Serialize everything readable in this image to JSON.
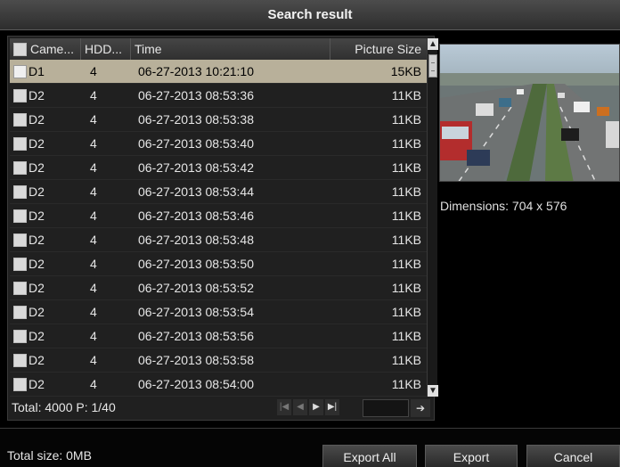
{
  "window": {
    "title": "Search result"
  },
  "table": {
    "headers": {
      "camera": "Came...",
      "hdd": "HDD...",
      "time": "Time",
      "size": "Picture Size"
    },
    "rows": [
      {
        "camera": "D1",
        "hdd": "4",
        "time": "06-27-2013 10:21:10",
        "size": "15KB",
        "selected": true
      },
      {
        "camera": "D2",
        "hdd": "4",
        "time": "06-27-2013 08:53:36",
        "size": "11KB"
      },
      {
        "camera": "D2",
        "hdd": "4",
        "time": "06-27-2013 08:53:38",
        "size": "11KB"
      },
      {
        "camera": "D2",
        "hdd": "4",
        "time": "06-27-2013 08:53:40",
        "size": "11KB"
      },
      {
        "camera": "D2",
        "hdd": "4",
        "time": "06-27-2013 08:53:42",
        "size": "11KB"
      },
      {
        "camera": "D2",
        "hdd": "4",
        "time": "06-27-2013 08:53:44",
        "size": "11KB"
      },
      {
        "camera": "D2",
        "hdd": "4",
        "time": "06-27-2013 08:53:46",
        "size": "11KB"
      },
      {
        "camera": "D2",
        "hdd": "4",
        "time": "06-27-2013 08:53:48",
        "size": "11KB"
      },
      {
        "camera": "D2",
        "hdd": "4",
        "time": "06-27-2013 08:53:50",
        "size": "11KB"
      },
      {
        "camera": "D2",
        "hdd": "4",
        "time": "06-27-2013 08:53:52",
        "size": "11KB"
      },
      {
        "camera": "D2",
        "hdd": "4",
        "time": "06-27-2013 08:53:54",
        "size": "11KB"
      },
      {
        "camera": "D2",
        "hdd": "4",
        "time": "06-27-2013 08:53:56",
        "size": "11KB"
      },
      {
        "camera": "D2",
        "hdd": "4",
        "time": "06-27-2013 08:53:58",
        "size": "11KB"
      },
      {
        "camera": "D2",
        "hdd": "4",
        "time": "06-27-2013 08:54:00",
        "size": "11KB"
      }
    ]
  },
  "pagination": {
    "total_text": "Total: 4000  P: 1/40",
    "icons": [
      "first-page-icon",
      "prev-page-icon",
      "next-page-icon",
      "last-page-icon",
      "go-arrow-icon"
    ]
  },
  "preview": {
    "dimensions_text": "Dimensions: 704 x 576"
  },
  "footer": {
    "total_size": "Total size: 0MB",
    "export_all_label": "Export All",
    "export_label": "Export",
    "cancel_label": "Cancel"
  },
  "colors": {
    "selected_row": "#b8b09a",
    "titlebar": "#3c3c3c"
  }
}
